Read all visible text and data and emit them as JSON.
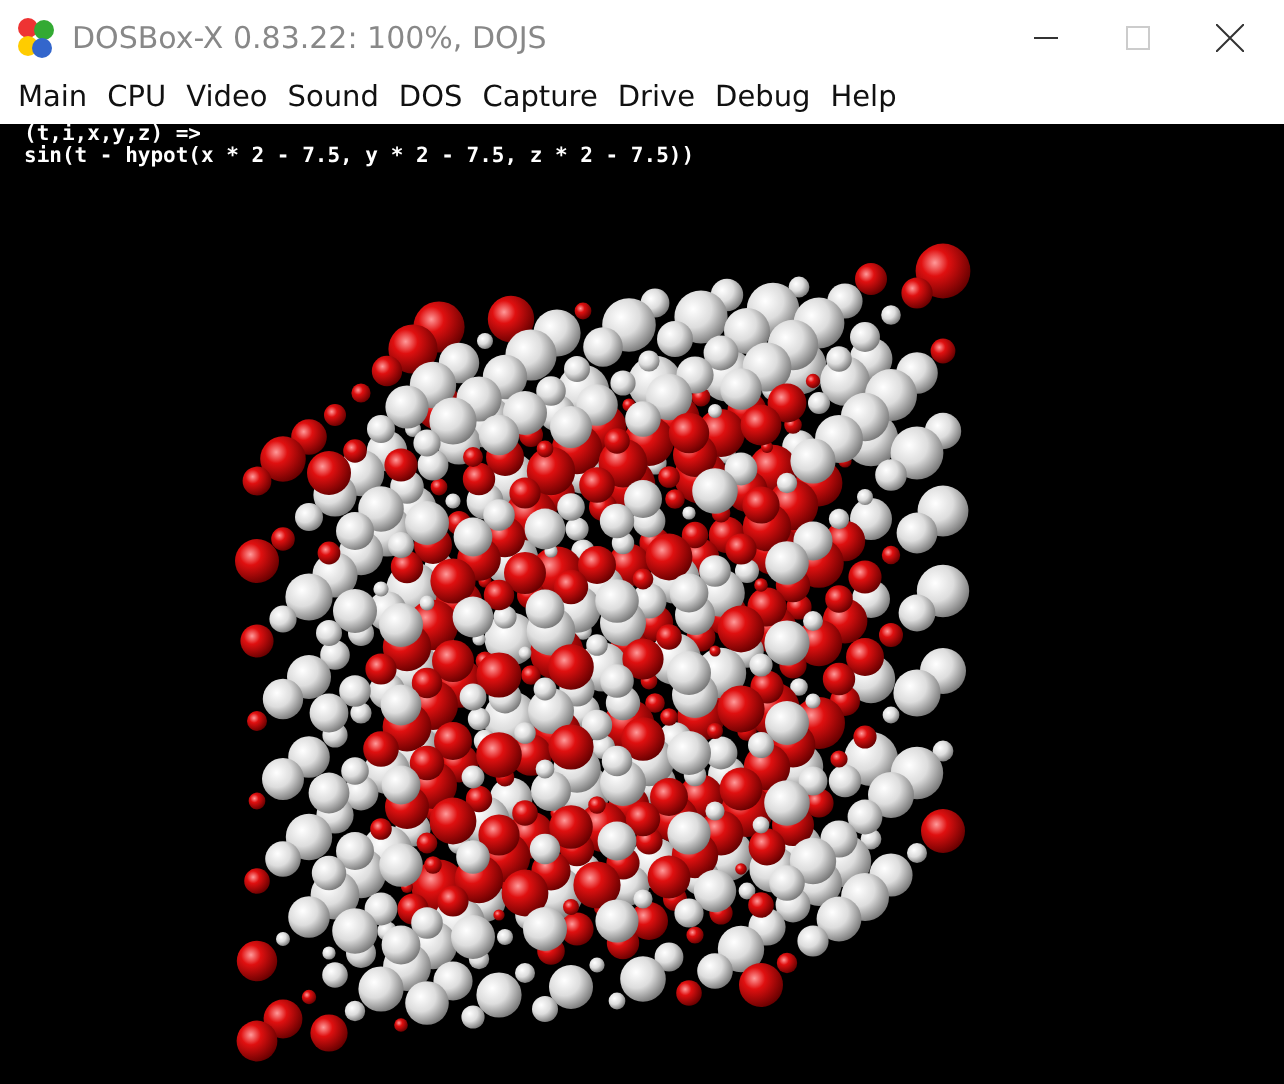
{
  "window": {
    "title": "DOSBox-X 0.83.22: 100%, DOJS",
    "controls": [
      {
        "kind": "minimize",
        "disabled": false
      },
      {
        "kind": "maximize",
        "disabled": true
      },
      {
        "kind": "close",
        "disabled": false
      }
    ]
  },
  "menu": [
    "Main",
    "CPU",
    "Video",
    "Sound",
    "DOS",
    "Capture",
    "Drive",
    "Debug",
    "Help"
  ],
  "console": {
    "lines": [
      "(t,i,x,y,z) =>",
      "sin(t - hypot(x * 2 - 7.5, y * 2 - 7.5, z * 2 - 7.5))"
    ]
  }
}
